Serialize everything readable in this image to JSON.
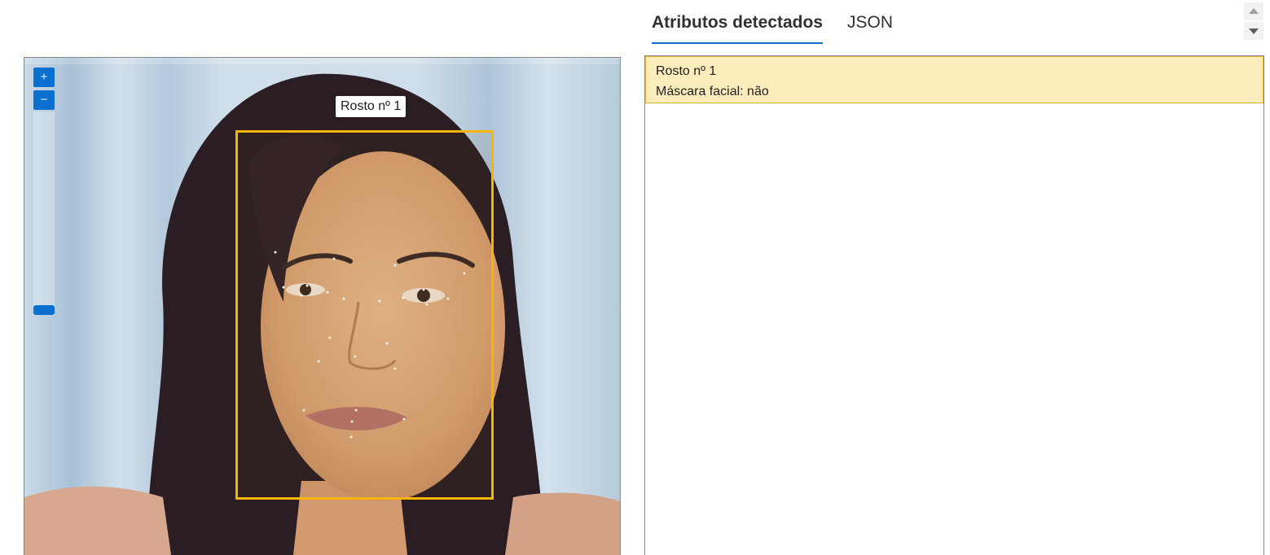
{
  "tabs": [
    {
      "label": "Atributos detectados",
      "active": true
    },
    {
      "label": "JSON",
      "active": false
    }
  ],
  "viewer": {
    "zoom_in_icon": "plus-icon",
    "zoom_out_icon": "minus-icon",
    "face_tag": "Rosto nº 1"
  },
  "results": [
    {
      "title": "Rosto nº 1",
      "attribute": "Máscara facial: não"
    }
  ],
  "colors": {
    "face_box": "#f7b500",
    "accent": "#0a6fce",
    "highlight": "#fdedbc"
  }
}
